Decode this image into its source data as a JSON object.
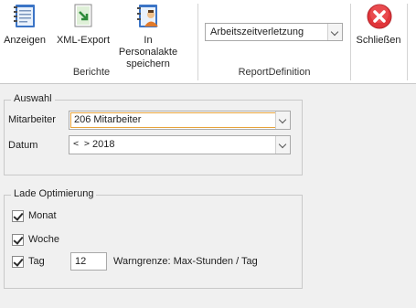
{
  "ribbon": {
    "berichte": {
      "group_label": "Berichte",
      "anzeigen_label": "Anzeigen",
      "xml_export_label": "XML-Export",
      "personalakte_label_line1": "In Personalakte",
      "personalakte_label_line2": "speichern"
    },
    "report_definition": {
      "group_label": "ReportDefinition",
      "selected": "Arbeitszeitverletzung"
    },
    "close": {
      "label": "Schließen"
    }
  },
  "auswahl": {
    "legend": "Auswahl",
    "mitarbeiter_label": "Mitarbeiter",
    "mitarbeiter_value": "206 Mitarbeiter",
    "datum_label": "Datum",
    "datum_nav": "< >",
    "datum_value": "2018"
  },
  "lade_optimierung": {
    "legend": "Lade Optimierung",
    "monat_label": "Monat",
    "monat_checked": true,
    "woche_label": "Woche",
    "woche_checked": true,
    "tag_label": "Tag",
    "tag_checked": true,
    "tag_value": "12",
    "warngrenze_label": "Warngrenze: Max-Stunden / Tag"
  },
  "icons": {
    "anzeigen": "report-view-icon",
    "xml_export": "xml-export-icon",
    "personalakte": "personnel-file-icon",
    "close": "close-icon"
  },
  "colors": {
    "close_red": "#e0353a",
    "highlight_border": "#e8a33a"
  }
}
